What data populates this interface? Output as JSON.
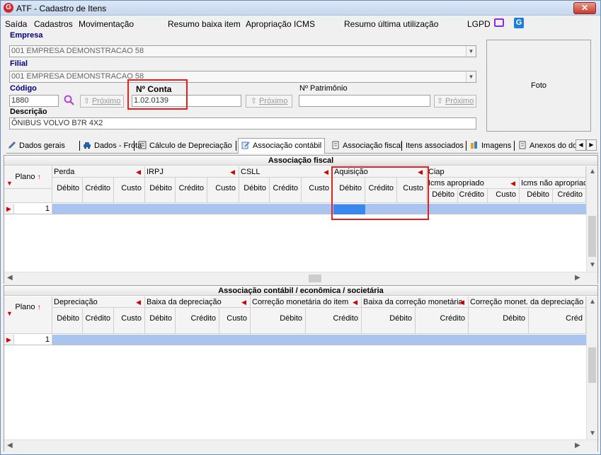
{
  "window": {
    "title": "ATF - Cadastro de Itens",
    "close_label": "✕"
  },
  "menu": {
    "items": [
      "Saída",
      "Cadastros",
      "Movimentação",
      "Resumo baixa item",
      "Apropriação ICMS",
      "Resumo última utilização",
      "LGPD"
    ]
  },
  "form": {
    "empresa_label": "Empresa",
    "empresa_value": "001 EMPRESA DEMONSTRACAO 58",
    "filial_label": "Filial",
    "filial_value": "001 EMPRESA DEMONSTRACAO 58",
    "codigo_label": "Código",
    "codigo_value": "1880",
    "proximo_label": "Próximo",
    "conta_label": "Nº Conta",
    "conta_value": "1.02.0139",
    "patrimonio_label": "Nº Patrimônio",
    "patrimonio_value": "",
    "descricao_label": "Descrição",
    "descricao_value": "ÔNIBUS VOLVO B7R 4X2",
    "foto_label": "Foto"
  },
  "tabs": [
    "Dados gerais",
    "Dados - Frota",
    "Cálculo de Depreciação",
    "Associação contábil",
    "Associação fiscal",
    "Itens associados",
    "Imagens",
    "Anexos do do"
  ],
  "grid1": {
    "title": "Associação fiscal",
    "plano_label": "Plano",
    "groups": [
      "Perda",
      "IRPJ",
      "CSLL",
      "Aquisição",
      "Ciap"
    ],
    "ciap_subgroups": [
      "Icms apropriado",
      "Icms não apropriad"
    ],
    "col_debito": "Débito",
    "col_credito": "Crédito",
    "col_custo": "Custo",
    "row_value": "1"
  },
  "grid2": {
    "title": "Associação contábil / econômica / societária",
    "plano_label": "Plano",
    "groups": [
      "Depreciação",
      "Baixa da depreciação",
      "Correção monetária do item",
      "Baixa da correção monetária",
      "Correção monet. da depreciação"
    ],
    "col_debito": "Débito",
    "col_credito": "Crédito",
    "col_custo": "Custo",
    "last_col_partial": "Créd",
    "row_value": "1"
  }
}
